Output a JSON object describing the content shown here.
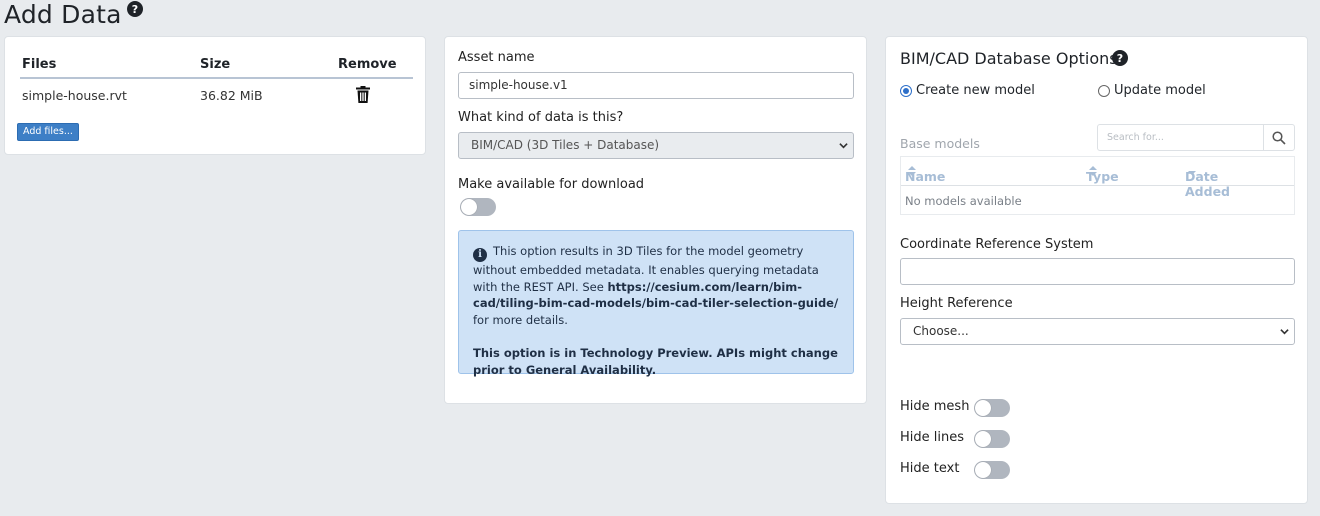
{
  "page": {
    "title": "Add Data",
    "help": "?"
  },
  "files": {
    "headers": {
      "files": "Files",
      "size": "Size",
      "remove": "Remove"
    },
    "rows": [
      {
        "name": "simple-house.rvt",
        "size": "36.82 MiB",
        "remove_icon": "trash-icon"
      }
    ],
    "add_button": "Add files..."
  },
  "asset": {
    "name_label": "Asset name",
    "name_value": "simple-house.v1",
    "kind_label": "What kind of data is this?",
    "kind_value": "BIM/CAD (3D Tiles + Database)",
    "download_label": "Make available for download",
    "download_on": false,
    "info": {
      "icon": "info-icon",
      "text_before": "This option results in 3D Tiles for the model geometry without embedded metadata. It enables querying metadata with the REST API. See ",
      "link": "https://cesium.com/learn/bim-cad/tiling-bim-cad-models/bim-cad-tiler-selection-guide/",
      "text_after": " for more details.",
      "preview_note": "This option is in Technology Preview. APIs might change prior to General Availability."
    }
  },
  "bim": {
    "title": "BIM/CAD Database Options",
    "help": "?",
    "radio_create": "Create new model",
    "radio_update": "Update model",
    "selected_radio": "create",
    "base_models_label": "Base models",
    "search_placeholder": "Search for...",
    "table_headers": {
      "name": "Name",
      "type": "Type",
      "date": "Date Added"
    },
    "empty_text": "No models available",
    "crs_label": "Coordinate Reference System",
    "crs_value": "",
    "height_label": "Height Reference",
    "height_value": "Choose...",
    "toggles": [
      {
        "label": "Hide mesh",
        "on": false
      },
      {
        "label": "Hide lines",
        "on": false
      },
      {
        "label": "Hide text",
        "on": false
      }
    ]
  },
  "colors": {
    "accent": "#3d7fc6",
    "info_bg": "#cfe2f6",
    "background": "#e8ebee"
  }
}
